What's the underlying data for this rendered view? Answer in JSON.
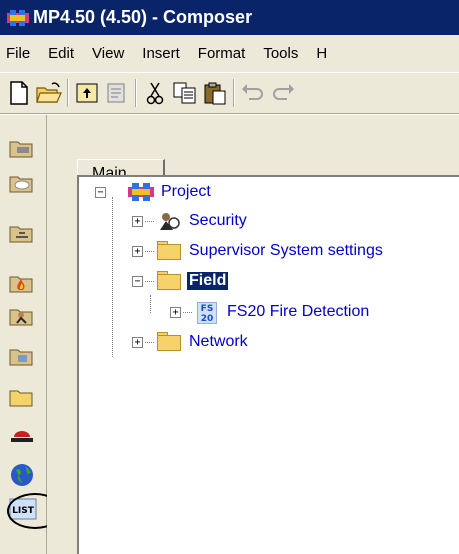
{
  "window": {
    "title": "MP4.50 (4.50) - Composer",
    "accent": "#0a246a"
  },
  "menu": [
    "File",
    "Edit",
    "View",
    "Insert",
    "Format",
    "Tools",
    "H"
  ],
  "toolbar": {
    "icons": [
      "new-document-icon",
      "open-folder-icon",
      "up-level-icon",
      "properties-icon",
      "cut-icon",
      "copy-icon",
      "paste-icon",
      "undo-icon",
      "redo-icon"
    ]
  },
  "sidebar": {
    "icons": [
      "tools-folder-icon",
      "cloud-folder-icon",
      "network-folder-icon",
      "fire-folder-icon",
      "security-folder-icon",
      "devices-folder-icon",
      "folder-icon",
      "alarm-icon",
      "globe-icon",
      "list-icon"
    ],
    "list_label": "LIST"
  },
  "tabs": {
    "main": "Main"
  },
  "tree": {
    "root": "Project",
    "security": "Security",
    "supervisor": "Supervisor System settings",
    "field": "Field",
    "fs20": "FS20 Fire Detection",
    "network": "Network",
    "fs_badge_top": "FS",
    "fs_badge_bottom": "20",
    "collapse_symbol": "−",
    "expand_symbol": "+"
  }
}
